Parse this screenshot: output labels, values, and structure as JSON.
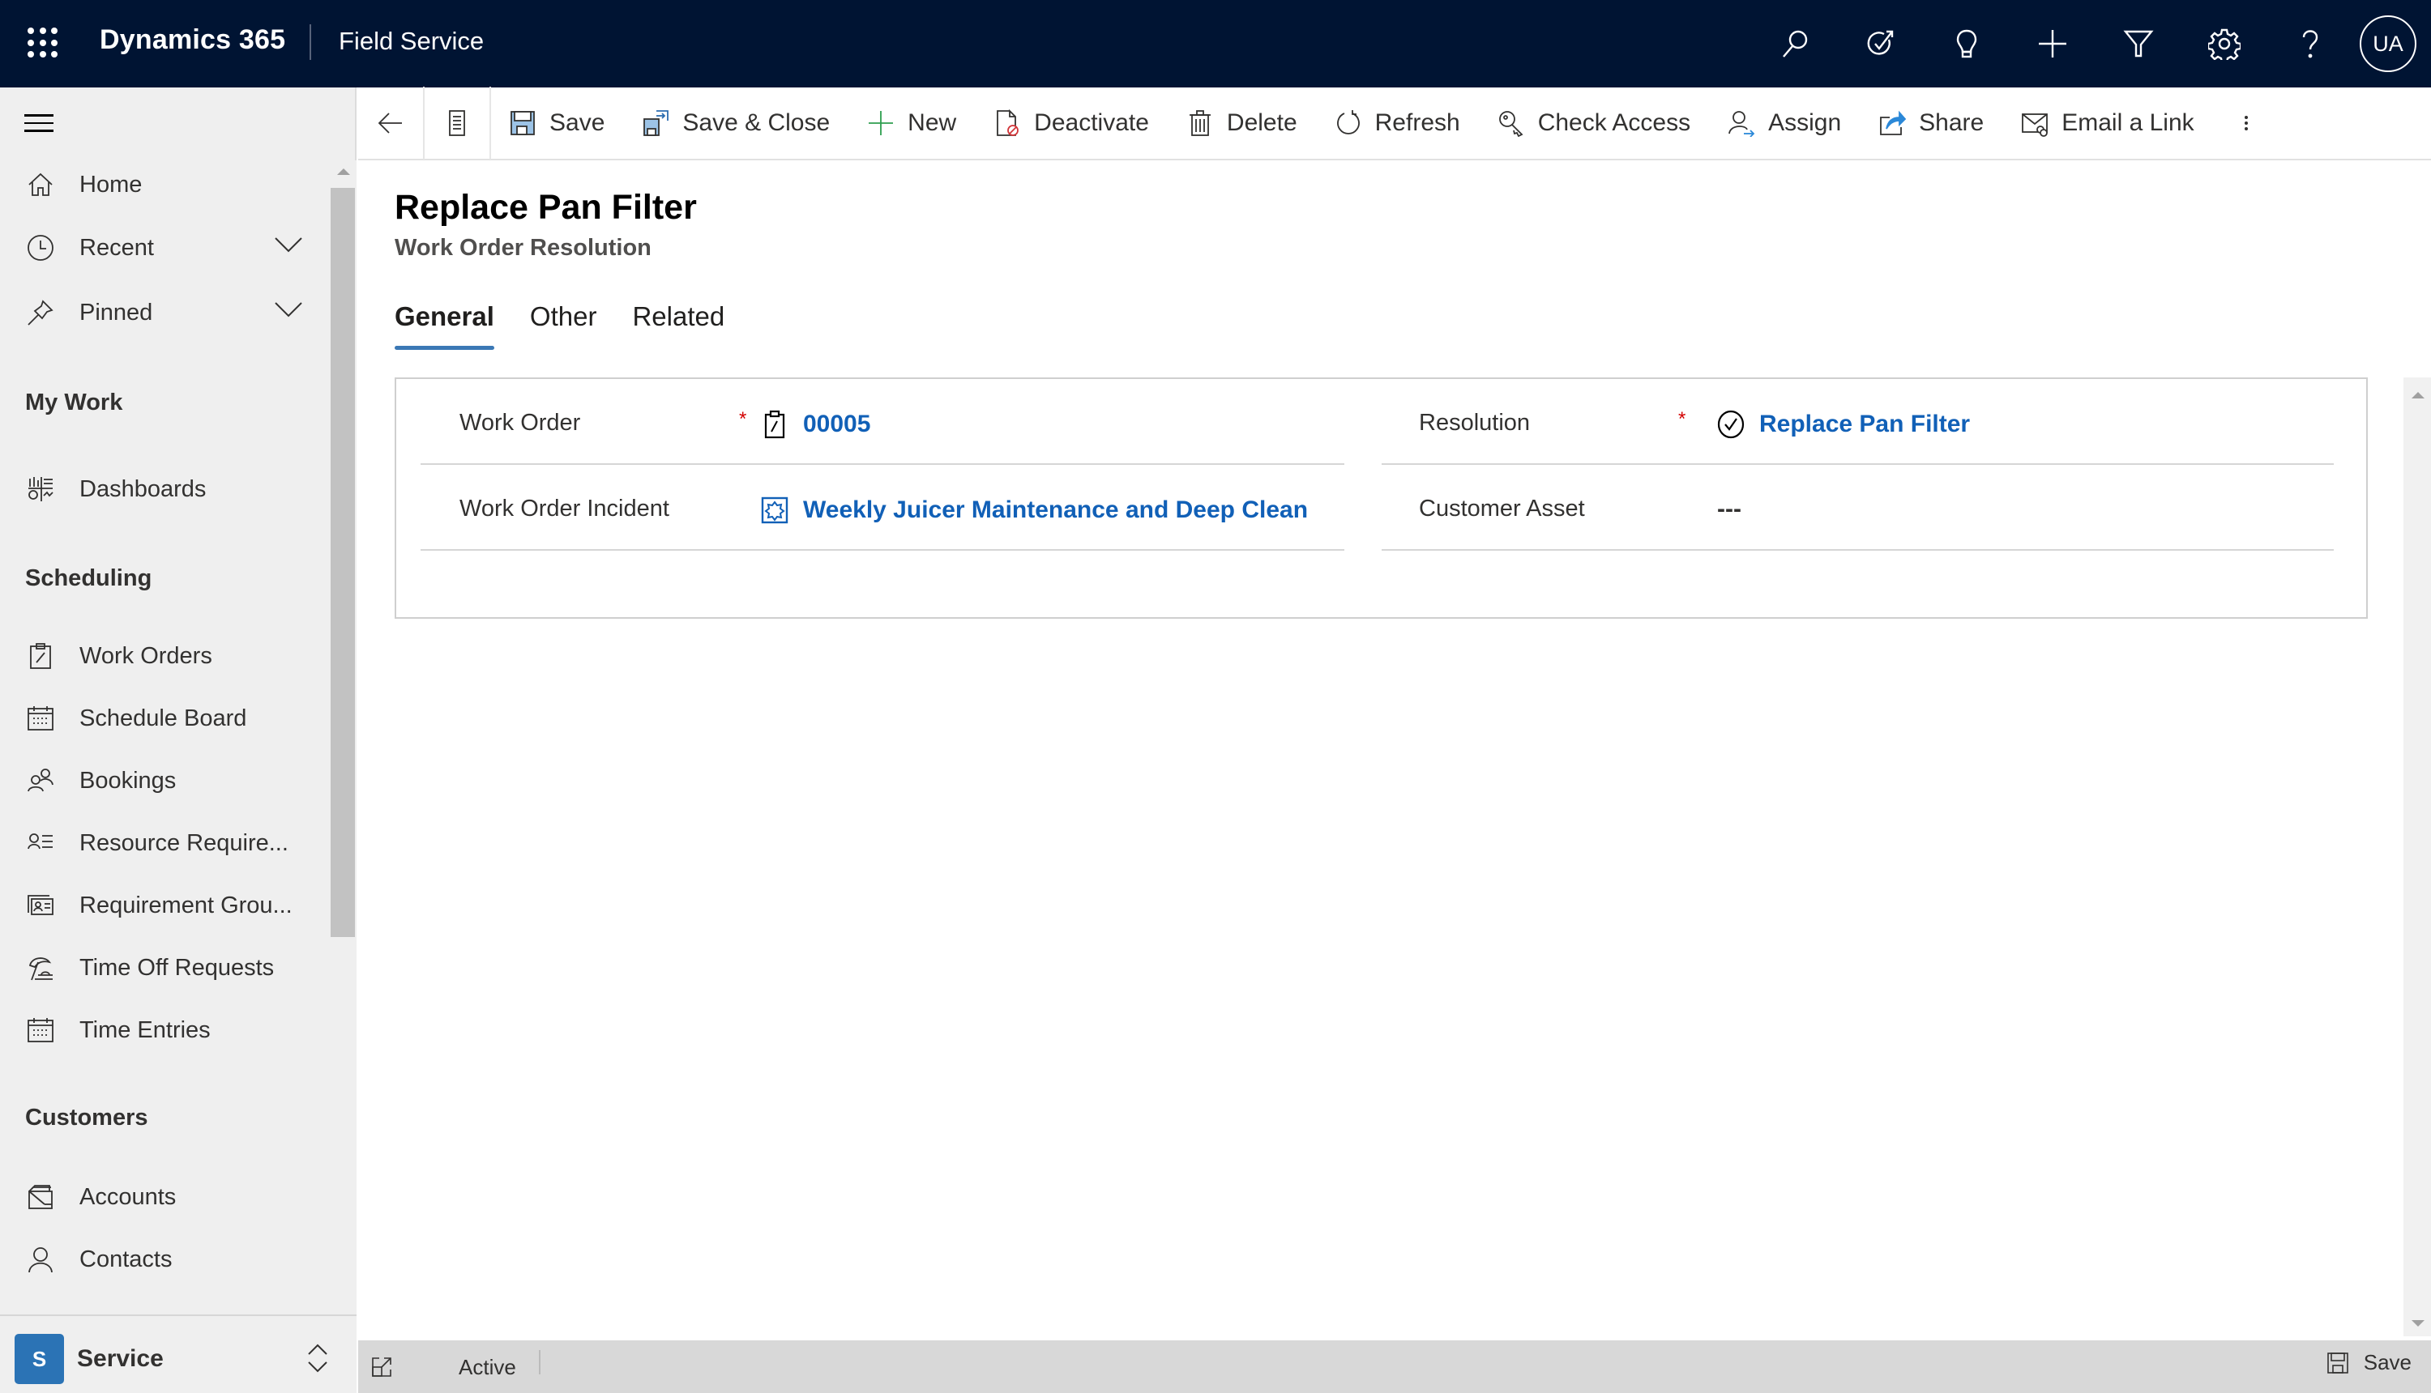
{
  "topbar": {
    "brand": "Dynamics 365",
    "app_name": "Field Service",
    "icons": [
      "search-icon",
      "task-check-icon",
      "lightbulb-icon",
      "add-icon",
      "filter-icon",
      "settings-icon",
      "help-icon"
    ],
    "user_initials": "UA"
  },
  "sidebar": {
    "top_items": [
      {
        "label": "Home",
        "icon": "home-icon"
      },
      {
        "label": "Recent",
        "icon": "clock-icon",
        "expandable": true
      },
      {
        "label": "Pinned",
        "icon": "pin-icon",
        "expandable": true
      }
    ],
    "groups": [
      {
        "title": "My Work",
        "items": [
          {
            "label": "Dashboards",
            "icon": "dashboard-icon"
          }
        ]
      },
      {
        "title": "Scheduling",
        "items": [
          {
            "label": "Work Orders",
            "icon": "clipboard-icon"
          },
          {
            "label": "Schedule Board",
            "icon": "calendar-icon"
          },
          {
            "label": "Bookings",
            "icon": "people-icon"
          },
          {
            "label": "Resource Require...",
            "icon": "person-list-icon"
          },
          {
            "label": "Requirement Grou...",
            "icon": "contact-card-icon"
          },
          {
            "label": "Time Off Requests",
            "icon": "beach-icon"
          },
          {
            "label": "Time Entries",
            "icon": "calendar-icon"
          }
        ]
      },
      {
        "title": "Customers",
        "items": [
          {
            "label": "Accounts",
            "icon": "accounts-icon"
          },
          {
            "label": "Contacts",
            "icon": "person-icon"
          }
        ]
      }
    ],
    "area": {
      "badge": "S",
      "name": "Service",
      "badge_color": "#2b73b5"
    }
  },
  "commandbar": {
    "buttons": [
      {
        "label": "Save",
        "icon": "save-icon"
      },
      {
        "label": "Save & Close",
        "icon": "save-close-icon"
      },
      {
        "label": "New",
        "icon": "add-icon"
      },
      {
        "label": "Deactivate",
        "icon": "deactivate-icon"
      },
      {
        "label": "Delete",
        "icon": "delete-icon"
      },
      {
        "label": "Refresh",
        "icon": "refresh-icon"
      },
      {
        "label": "Check Access",
        "icon": "key-icon"
      },
      {
        "label": "Assign",
        "icon": "assign-icon"
      },
      {
        "label": "Share",
        "icon": "share-icon"
      },
      {
        "label": "Email a Link",
        "icon": "email-link-icon"
      }
    ]
  },
  "record": {
    "title": "Replace Pan Filter",
    "entity": "Work Order Resolution",
    "tabs": [
      {
        "label": "General",
        "active": true
      },
      {
        "label": "Other",
        "active": false
      },
      {
        "label": "Related",
        "active": false
      }
    ],
    "fields": {
      "work_order": {
        "label": "Work Order",
        "required": "*",
        "value": "00005"
      },
      "work_order_incident": {
        "label": "Work Order Incident",
        "value": "Weekly Juicer Maintenance and Deep Clean"
      },
      "resolution": {
        "label": "Resolution",
        "required": "*",
        "value": "Replace Pan Filter"
      },
      "customer_asset": {
        "label": "Customer Asset",
        "value": "---"
      }
    }
  },
  "statusbar": {
    "status": "Active",
    "save_label": "Save"
  },
  "colors": {
    "topbar": "#001433",
    "link": "#1160b7",
    "tab_underline": "#3b78b5",
    "required": "#d30000",
    "new_icon": "#2e9e4f",
    "deactivate_badge": "#d13438",
    "share_icon": "#2b88d8"
  }
}
